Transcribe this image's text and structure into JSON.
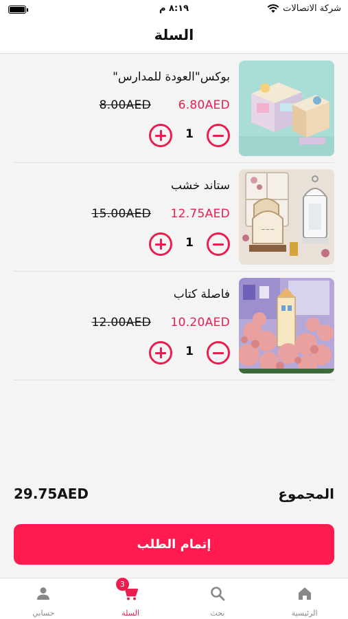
{
  "status_bar": {
    "carrier": "شركة الاتصالات",
    "time": "٨:١٩ م"
  },
  "header": {
    "title": "السلة"
  },
  "cart": {
    "items": [
      {
        "name": "بوكس\"العودة للمدارس\"",
        "price": "6.80AED",
        "old_price": "8.00AED",
        "qty": "1"
      },
      {
        "name": "ستاند خشب",
        "price": "12.75AED",
        "old_price": "15.00AED",
        "qty": "1"
      },
      {
        "name": "فاصلة كتاب",
        "price": "10.20AED",
        "old_price": "12.00AED",
        "qty": "1"
      }
    ]
  },
  "summary": {
    "total_label": "المجموع",
    "total_value": "29.75AED"
  },
  "checkout": {
    "label": "إتمام الطلب"
  },
  "nav": {
    "items": [
      {
        "label": "الرئيسية",
        "icon": "home-icon"
      },
      {
        "label": "بحث",
        "icon": "search-icon"
      },
      {
        "label": "السلة",
        "icon": "cart-icon",
        "badge": "3",
        "active": true
      },
      {
        "label": "حسابي",
        "icon": "user-icon"
      }
    ]
  },
  "colors": {
    "accent": "#e91e4f",
    "button": "#ff1a4f"
  }
}
